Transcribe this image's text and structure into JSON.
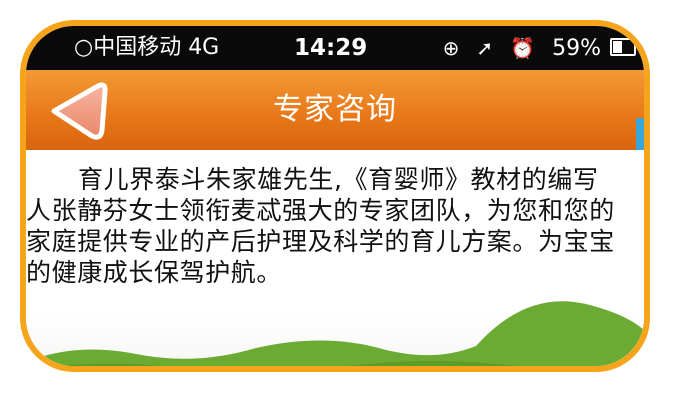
{
  "status_bar": {
    "carrier": "○中国移动  4G",
    "time": "14:29",
    "lock_rotation_glyph": "⊕",
    "location_glyph": "➚",
    "alarm_glyph": "⏰",
    "battery_percent": "59%",
    "battery_level": 0.59
  },
  "nav": {
    "title": "专家咨询",
    "back_icon": "back-arrow-icon"
  },
  "content": {
    "intro": "育儿界泰斗朱家雄先生,《育婴师》教材的编写人张静芬女士领衔麦忒强大的专家团队，为您和您的家庭提供专业的产后护理及科学的育儿方案。为宝宝的健康成长保驾护航。"
  },
  "colors": {
    "frame_border": "#f6a41b",
    "nav_bar": "#e9791a",
    "hills": "#6cab33",
    "status_bar": "#0a0a0a",
    "right_edge": "#3aa6d8"
  }
}
